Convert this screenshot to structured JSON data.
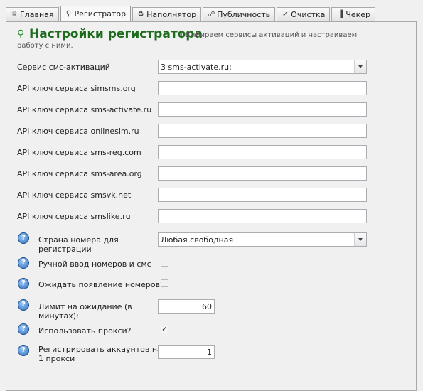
{
  "tabs": [
    {
      "label": "Главная",
      "icon": "crown-icon",
      "glyph": "♕"
    },
    {
      "label": "Регистратор",
      "icon": "key-icon",
      "glyph": "⚲"
    },
    {
      "label": "Наполнятор",
      "icon": "refresh-icon",
      "glyph": "♻"
    },
    {
      "label": "Публичность",
      "icon": "handshake-icon",
      "glyph": "☍"
    },
    {
      "label": "Очистка",
      "icon": "check-icon",
      "glyph": "✓"
    },
    {
      "label": "Чекер",
      "icon": "checker-icon",
      "glyph": "▐"
    }
  ],
  "active_tab": 1,
  "header": {
    "title_glyph": "⚲",
    "title": "Настройки регистратора",
    "subtitle_line1": "| Выбираем сервисы активаций и настраиваем",
    "subtitle_line2": "работу с ними."
  },
  "service": {
    "label": "Сервис смс-активаций",
    "value": "3 sms-activate.ru;"
  },
  "api_keys": [
    {
      "label": "API ключ сервиса simsms.org",
      "value": ""
    },
    {
      "label": "API ключ сервиса sms-activate.ru",
      "value": ""
    },
    {
      "label": "API ключ сервиса onlinesim.ru",
      "value": ""
    },
    {
      "label": "API ключ сервиса sms-reg.com",
      "value": ""
    },
    {
      "label": "API ключ сервиса sms-area.org",
      "value": ""
    },
    {
      "label": "API ключ сервиса smsvk.net",
      "value": ""
    },
    {
      "label": "API ключ сервиса smslike.ru",
      "value": ""
    }
  ],
  "help_glyph": "?",
  "check_glyph": "✓",
  "options": {
    "country": {
      "label_line1": "Страна номера для",
      "label_line2": "регистрации",
      "value": "Любая свободная"
    },
    "manual_input": {
      "label": "Ручной ввод номеров и смс",
      "checked": false
    },
    "wait_numbers": {
      "label": "Ожидать появление номеров?",
      "checked": false
    },
    "wait_limit": {
      "label_line1": "Лимит на ожидание (в",
      "label_line2": "минутах):",
      "value": "60"
    },
    "use_proxy": {
      "label": "Использовать прокси?",
      "checked": true
    },
    "accounts_per_proxy": {
      "label_line1": "Регистрировать аккаунтов на",
      "label_line2": "1 прокси",
      "value": "1"
    }
  }
}
